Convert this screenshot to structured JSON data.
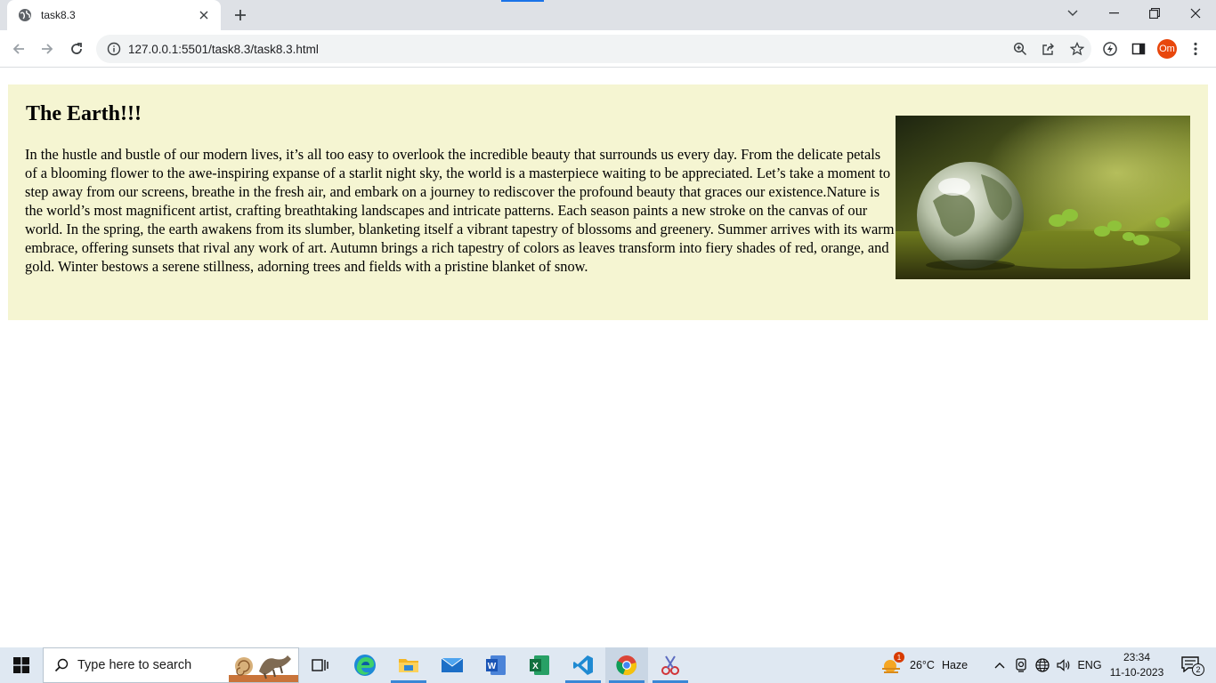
{
  "browser": {
    "tab": {
      "title": "task8.3"
    },
    "address": {
      "url": "127.0.0.1:5501/task8.3/task8.3.html"
    },
    "profile": {
      "initials": "Om"
    }
  },
  "page": {
    "heading": "The Earth!!!",
    "paragraph": "In the hustle and bustle of our modern lives, it’s all too easy to overlook the incredible beauty that surrounds us every day. From the delicate petals of a blooming flower to the awe-inspiring expanse of a starlit night sky, the world is a masterpiece waiting to be appreciated. Let’s take a moment to step away from our screens, breathe in the fresh air, and embark on a journey to rediscover the profound beauty that graces our existence.Nature is the world’s most magnificent artist, crafting breathtaking landscapes and intricate patterns. Each season paints a new stroke on the canvas of our world. In the spring, the earth awakens from its slumber, blanketing itself a vibrant tapestry of blossoms and greenery. Summer arrives with its warm embrace, offering sunsets that rival any work of art. Autumn brings a rich tapestry of colors as leaves transform into fiery shades of red, orange, and gold. Winter bestows a serene stillness, adorning trees and fields with a pristine blanket of snow.",
    "background_color": "#f5f5d2"
  },
  "taskbar": {
    "search_placeholder": "Type here to search",
    "weather": {
      "temperature": "26°C",
      "condition": "Haze",
      "alert_count": "1"
    },
    "language": "ENG",
    "clock": {
      "time": "23:34",
      "date": "11-10-2023"
    },
    "notification_count": "2",
    "apps": [
      "task-view",
      "edge",
      "file-explorer",
      "mail",
      "word",
      "excel",
      "vscode",
      "chrome",
      "snipping-tool"
    ]
  }
}
